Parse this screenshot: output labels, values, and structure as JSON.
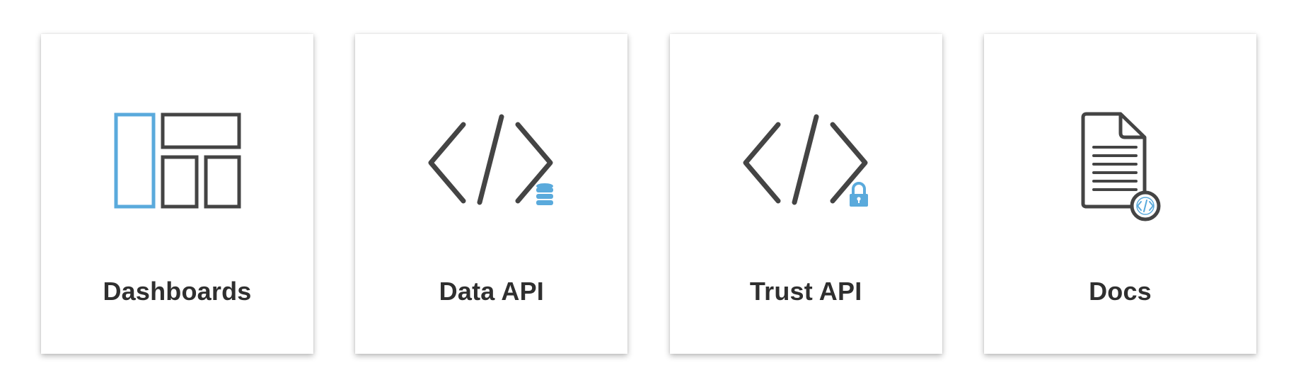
{
  "colors": {
    "accent": "#5aaadc",
    "icon_stroke": "#444444",
    "text": "#2f2f2f",
    "card_bg": "#ffffff"
  },
  "cards": [
    {
      "label": "Dashboards",
      "icon": "dashboard-layout-icon"
    },
    {
      "label": "Data API",
      "icon": "code-database-icon"
    },
    {
      "label": "Trust API",
      "icon": "code-lock-icon"
    },
    {
      "label": "Docs",
      "icon": "document-code-icon"
    }
  ]
}
